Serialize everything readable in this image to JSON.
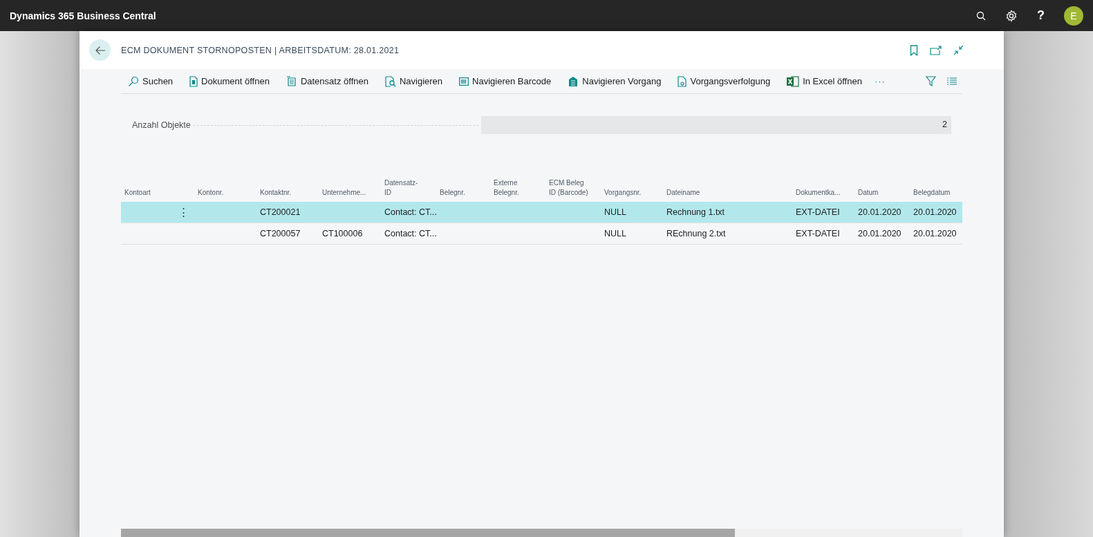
{
  "app_bar": {
    "title": "Dynamics 365 Business Central",
    "help": "?",
    "avatar": "E"
  },
  "page": {
    "title": "ECM DOKUMENT STORNOPOSTEN | ARBEITSDATUM: 28.01.2021"
  },
  "actions": [
    {
      "kind": "search",
      "label": "Suchen"
    },
    {
      "kind": "document",
      "label": "Dokument öffnen"
    },
    {
      "kind": "record",
      "label": "Datensatz öffnen"
    },
    {
      "kind": "navigate",
      "label": "Navigieren"
    },
    {
      "kind": "barcode",
      "label": "Navigieren Barcode"
    },
    {
      "kind": "process",
      "label": "Navigieren Vorgang"
    },
    {
      "kind": "tracking",
      "label": "Vorgangsverfolgung"
    },
    {
      "kind": "excel",
      "label": "In Excel öffnen"
    }
  ],
  "more_actions": "···",
  "summary": {
    "label": "Anzahl Objekte",
    "value": "2"
  },
  "table": {
    "columns": [
      "Kontoart",
      "Kontonr.",
      "Kontaktnr.",
      "Unternehme...",
      "Datensatz-\nID",
      "Belegnr.",
      "Externe\nBelegnr.",
      "ECM Beleg\nID (Barcode)",
      "Vorgangsnr.",
      "Dateiname",
      "Dokumentka...",
      "Datum",
      "Belegdatum"
    ],
    "rows": [
      {
        "selected": true,
        "row_menu": "⋮",
        "cells": [
          "",
          "",
          "CT200021",
          "",
          "Contact: CT...",
          "",
          "",
          "",
          "NULL",
          "Rechnung 1.txt",
          "EXT-DATEI",
          "20.01.2020",
          "20.01.2020"
        ]
      },
      {
        "selected": false,
        "cells": [
          "",
          "",
          "CT200057",
          "CT100006",
          "Contact: CT...",
          "",
          "",
          "",
          "NULL",
          "REchnung 2.txt",
          "EXT-DATEI",
          "20.01.2020",
          "20.01.2020"
        ]
      }
    ]
  }
}
